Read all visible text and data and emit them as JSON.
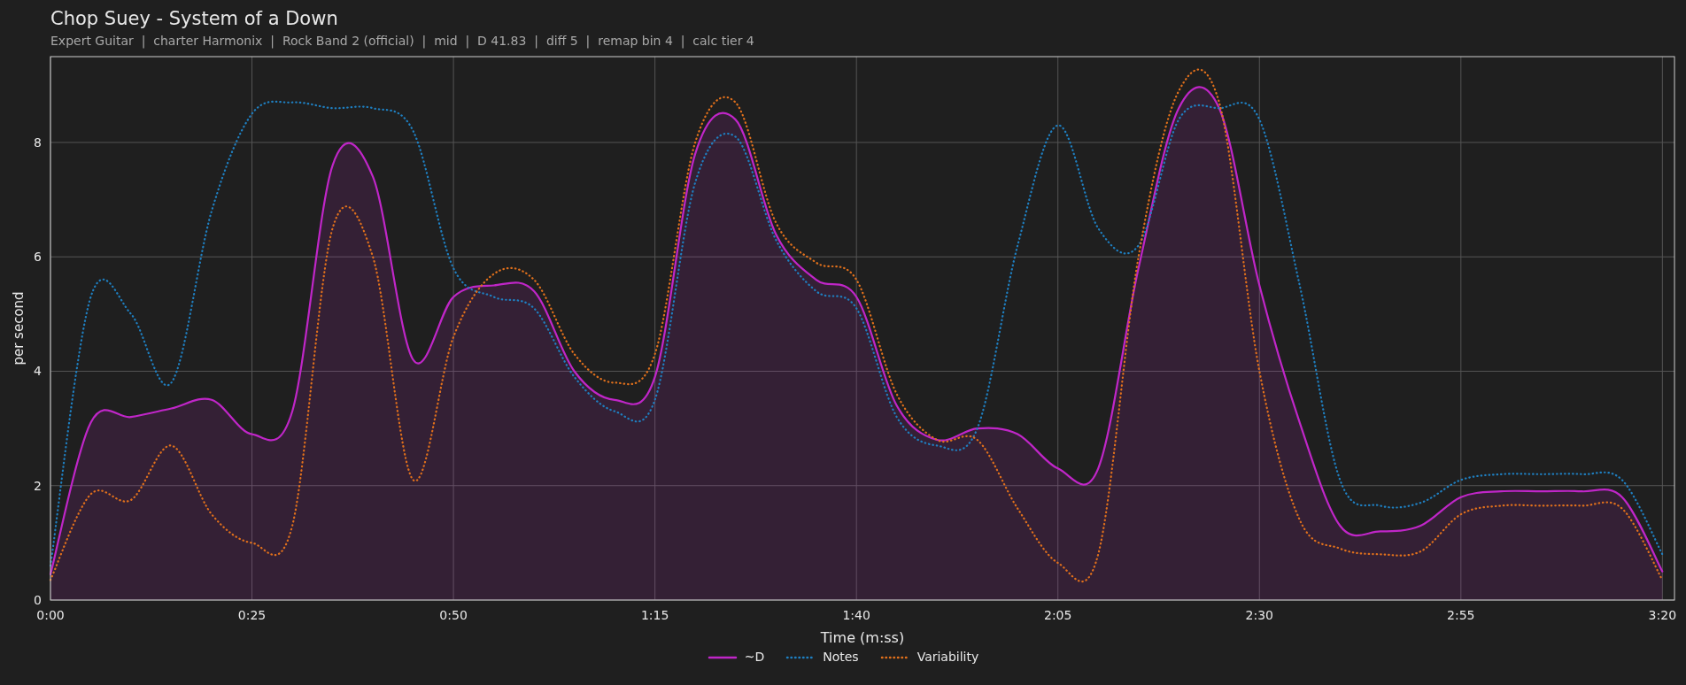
{
  "title": "Chop Suey - System of a Down",
  "subtitle": "Expert Guitar  |  charter Harmonix  |  Rock Band 2 (official)  |  mid  |  D 41.83  |  diff 5  |  remap bin 4  |  calc tier 4",
  "chart": {
    "chart_data": {
      "type": "line",
      "grid": true,
      "xlabel": "Time (m:ss)",
      "ylabel": "per second",
      "x": [
        0,
        5,
        10,
        15,
        20,
        25,
        30,
        35,
        40,
        45,
        50,
        55,
        60,
        65,
        70,
        75,
        80,
        85,
        90,
        95,
        100,
        105,
        110,
        115,
        120,
        125,
        130,
        135,
        140,
        145,
        150,
        155,
        160,
        165,
        170,
        175,
        180,
        185,
        190,
        195,
        200
      ],
      "series": [
        {
          "name": "~D",
          "color": "#c026c8",
          "type": "area",
          "line_style": "solid",
          "values": [
            0.45,
            3.1,
            3.2,
            3.35,
            3.5,
            2.9,
            3.3,
            7.6,
            7.4,
            4.2,
            5.3,
            5.5,
            5.4,
            4.0,
            3.5,
            3.9,
            7.8,
            8.4,
            6.4,
            5.6,
            5.3,
            3.4,
            2.8,
            3.0,
            2.9,
            2.3,
            2.3,
            5.8,
            8.6,
            8.6,
            5.5,
            3.1,
            1.3,
            1.2,
            1.3,
            1.8,
            1.9,
            1.9,
            1.9,
            1.8,
            0.5
          ]
        },
        {
          "name": "Notes",
          "color": "#1f7fc0",
          "type": "line",
          "line_style": "dotted",
          "values": [
            0.6,
            5.3,
            5.0,
            3.8,
            6.8,
            8.5,
            8.7,
            8.6,
            8.6,
            8.2,
            5.8,
            5.3,
            5.1,
            3.9,
            3.3,
            3.5,
            7.3,
            8.1,
            6.3,
            5.4,
            5.1,
            3.2,
            2.7,
            3.0,
            6.2,
            8.3,
            6.5,
            6.2,
            8.4,
            8.6,
            8.4,
            5.5,
            2.1,
            1.65,
            1.7,
            2.1,
            2.2,
            2.2,
            2.2,
            2.1,
            0.8
          ]
        },
        {
          "name": "Variability",
          "color": "#e0701c",
          "type": "line",
          "line_style": "dotted",
          "values": [
            0.35,
            1.85,
            1.75,
            2.7,
            1.5,
            1.0,
            1.3,
            6.5,
            6.0,
            2.1,
            4.6,
            5.7,
            5.6,
            4.3,
            3.8,
            4.3,
            8.0,
            8.7,
            6.6,
            5.9,
            5.6,
            3.6,
            2.8,
            2.8,
            1.6,
            0.65,
            0.8,
            6.0,
            8.9,
            8.7,
            4.0,
            1.4,
            0.9,
            0.8,
            0.85,
            1.5,
            1.65,
            1.65,
            1.65,
            1.6,
            0.35
          ]
        }
      ],
      "xlim": [
        0,
        201.5
      ],
      "ylim": [
        0,
        9.5
      ],
      "xticks": [
        {
          "value": 0,
          "label": "0:00"
        },
        {
          "value": 25,
          "label": "0:25"
        },
        {
          "value": 50,
          "label": "0:50"
        },
        {
          "value": 75,
          "label": "1:15"
        },
        {
          "value": 100,
          "label": "1:40"
        },
        {
          "value": 125,
          "label": "2:05"
        },
        {
          "value": 150,
          "label": "2:30"
        },
        {
          "value": 175,
          "label": "2:55"
        },
        {
          "value": 200,
          "label": "3:20"
        }
      ],
      "yticks": [
        0,
        2,
        4,
        6,
        8
      ]
    }
  }
}
